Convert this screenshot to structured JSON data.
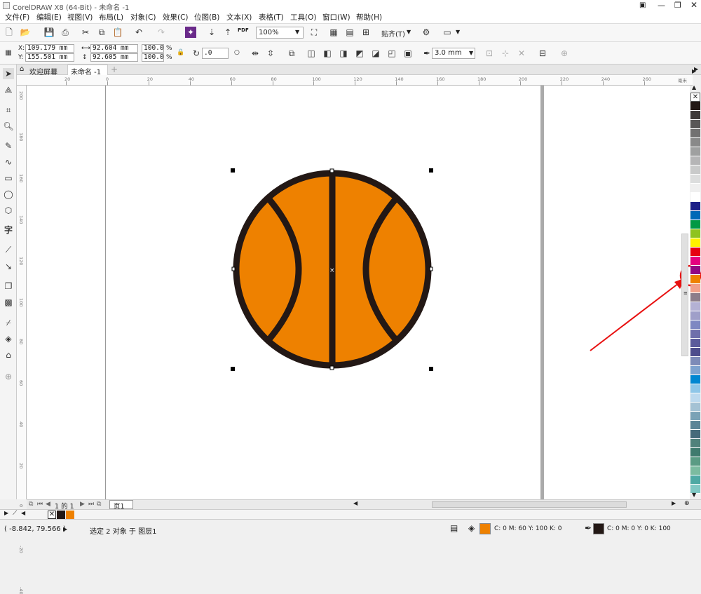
{
  "window": {
    "title": "CorelDRAW X8 (64-Bit) - 未命名 -1"
  },
  "menu": [
    "文件(F)",
    "编辑(E)",
    "视图(V)",
    "布局(L)",
    "对象(C)",
    "效果(C)",
    "位图(B)",
    "文本(X)",
    "表格(T)",
    "工具(O)",
    "窗口(W)",
    "帮助(H)"
  ],
  "toolbar": {
    "zoom": "100%",
    "snap_label": "贴齐(T)",
    "pdf_label": "PDF"
  },
  "props": {
    "x": "109.179 mm",
    "y": "155.501 mm",
    "width": "92.604 mm",
    "height": "92.605 mm",
    "scale_w": "100.0",
    "scale_h": "100.0",
    "pct": "%",
    "rotation": ".0",
    "outline_width": "3.0 mm",
    "x_label": "X:",
    "y_label": "Y:"
  },
  "tabs": {
    "welcome": "欢迎屏幕",
    "doc": "未命名 -1"
  },
  "ruler": {
    "h_ticks": [
      "20",
      "0",
      "20",
      "40",
      "60",
      "80",
      "100",
      "120",
      "140",
      "160",
      "180",
      "200",
      "220",
      "240",
      "260"
    ],
    "v_ticks": [
      "200",
      "180",
      "160",
      "140",
      "120",
      "100",
      "80",
      "60",
      "40",
      "20",
      "0",
      "-20",
      "-40"
    ],
    "units": "毫米"
  },
  "page_nav": {
    "page_count": "1 的 1",
    "page_tab": "页1"
  },
  "status": {
    "coords": "( -8.842, 79.566 )",
    "selection": "选定 2 对象 于 图层1",
    "fill_label": "C: 0 M: 60 Y: 100 K: 0",
    "outline_label": "C: 0 M: 0 Y: 0 K: 100"
  },
  "colors": {
    "ball_fill": "#ee8100",
    "ball_stroke": "#231815",
    "annotation": "#e81010"
  },
  "palette": [
    "#ffffff",
    "#231815",
    "#3e3a39",
    "#595757",
    "#727171",
    "#898989",
    "#9fa0a0",
    "#b5b5b6",
    "#c9caca",
    "#dcdddd",
    "#efefef",
    "#ffffff",
    "#1d2088",
    "#0068b7",
    "#009944",
    "#8fc31f",
    "#fff100",
    "#e60012",
    "#e4007f",
    "#920783",
    "#ee8100",
    "#f0a08a",
    "#8c7d8a",
    "#b4b1d4",
    "#9f9fc9",
    "#7e88c2",
    "#6f6fab",
    "#5b5b9b",
    "#4d4d8c",
    "#7d8bb8",
    "#7fa3cf",
    "#0086d1",
    "#8ec6e8",
    "#bcd9ee",
    "#a4c2d4",
    "#7aa2b6",
    "#5d8597",
    "#466a7a",
    "#50817b",
    "#3f7a6e",
    "#5a9b84",
    "#7bbba0",
    "#4ea9a4",
    "#80c8c4"
  ]
}
